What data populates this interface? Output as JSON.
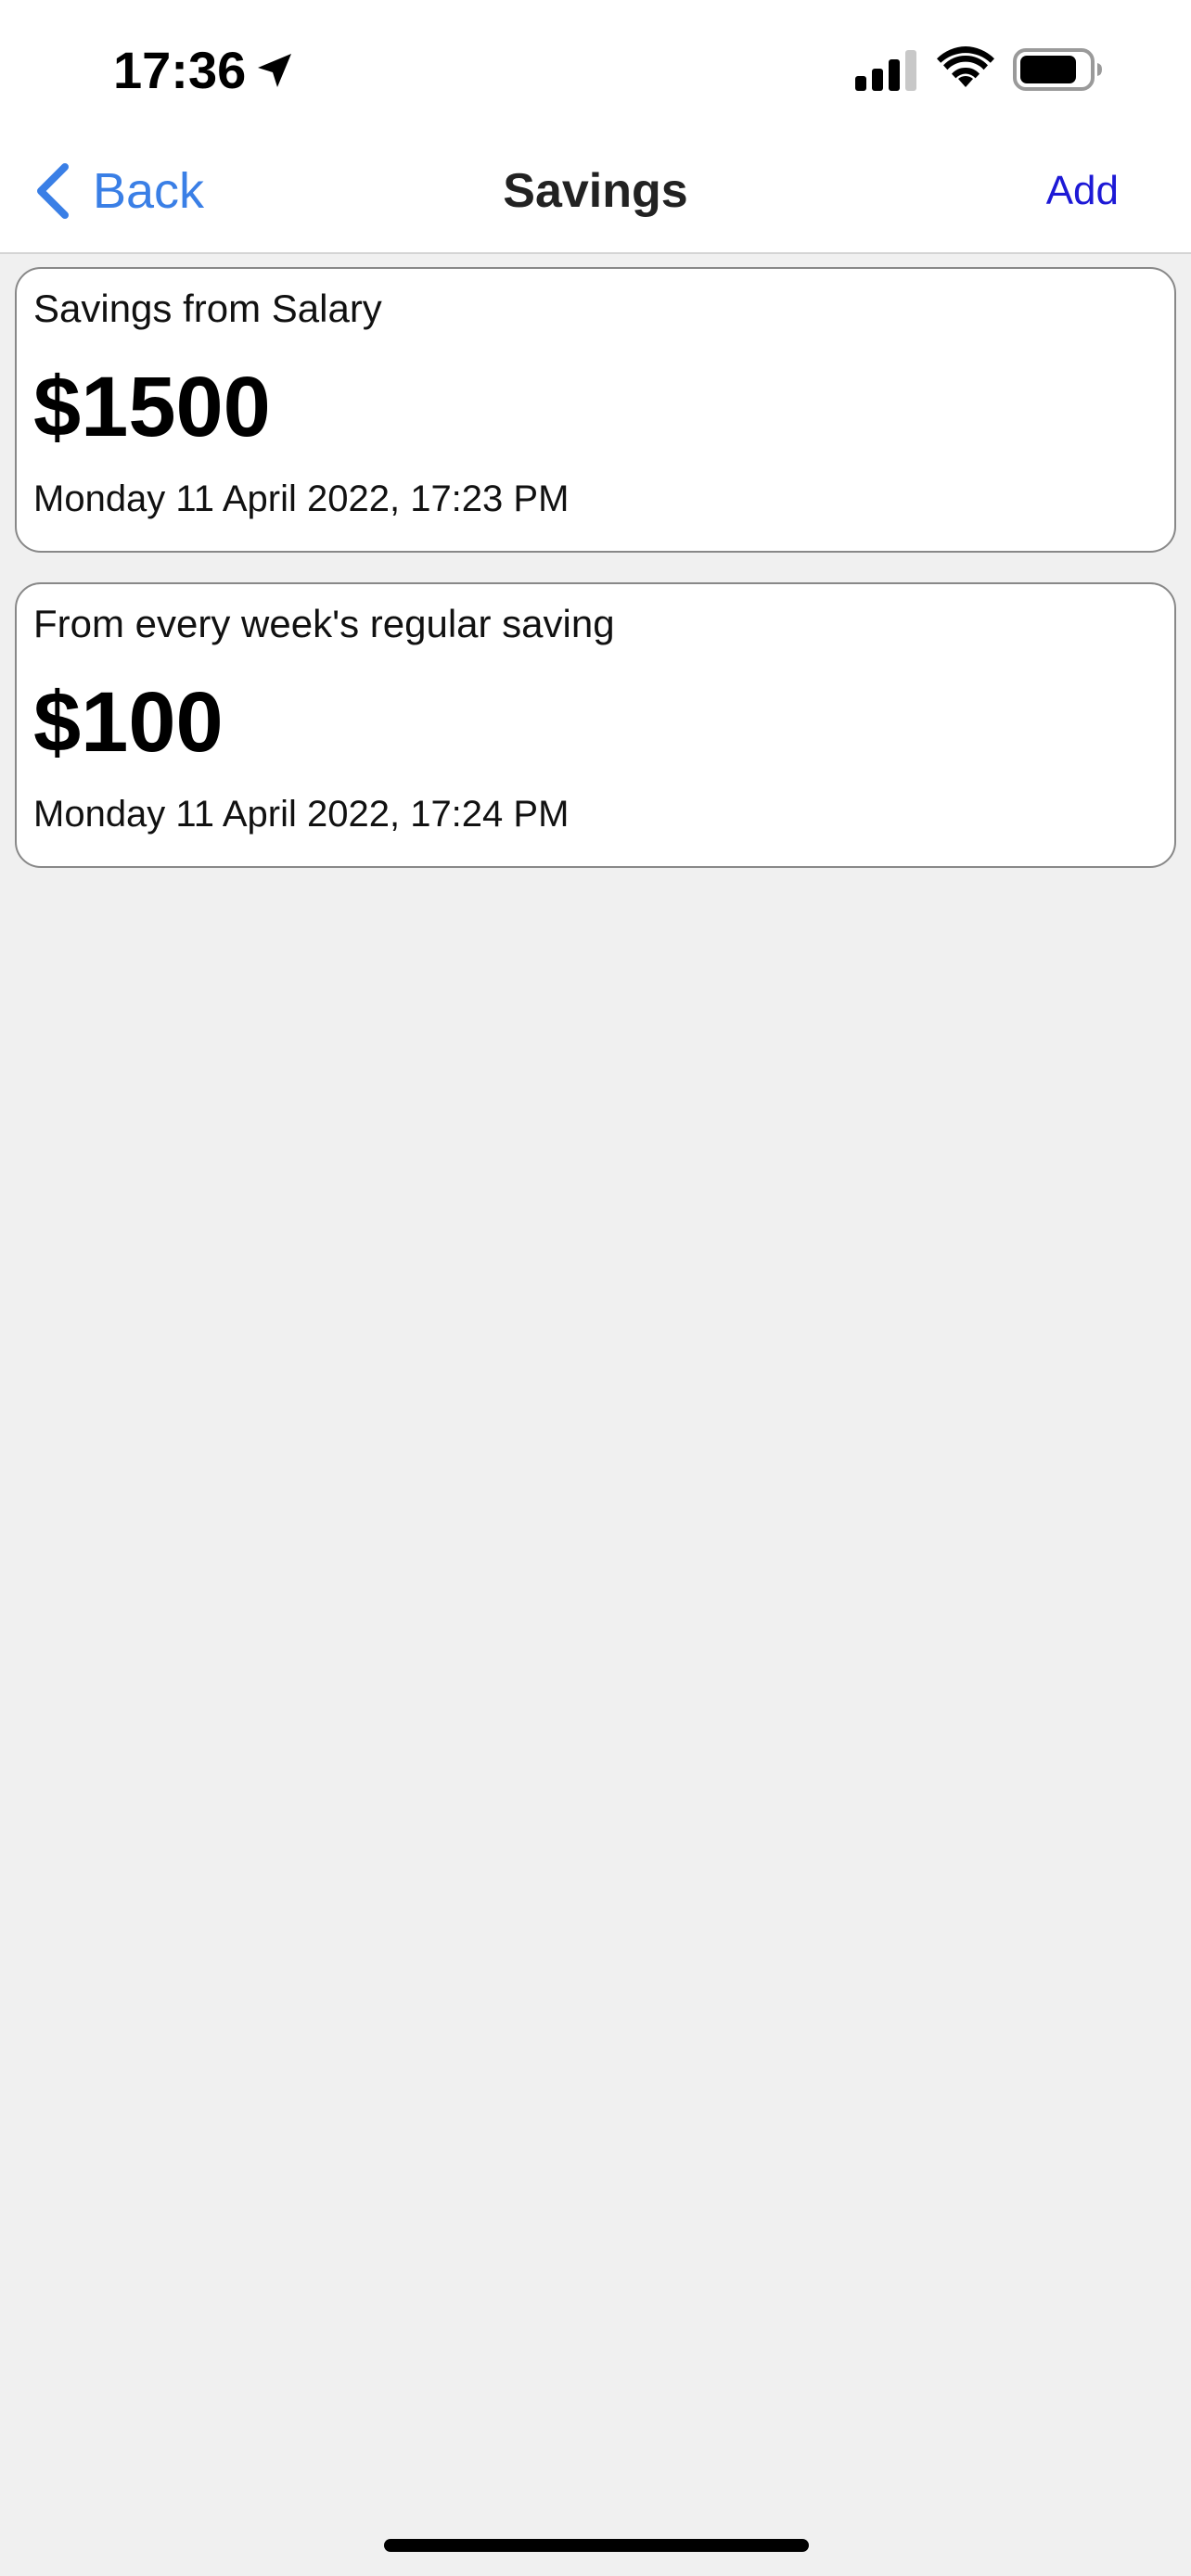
{
  "status_bar": {
    "time": "17:36",
    "icons": [
      "location-arrow-icon",
      "cellular-signal-icon",
      "wifi-icon",
      "battery-icon"
    ]
  },
  "nav": {
    "back_label": "Back",
    "title": "Savings",
    "add_label": "Add"
  },
  "savings": [
    {
      "title": "Savings from Salary",
      "amount": "$1500",
      "date": "Monday 11 April 2022, 17:23 PM"
    },
    {
      "title": "From every week's regular saving",
      "amount": "$100",
      "date": "Monday 11 April 2022, 17:24 PM"
    }
  ],
  "colors": {
    "back_accent": "#3a7fe6",
    "add_accent": "#1d19d6",
    "background": "#f0f0f0",
    "card_border": "#888888"
  }
}
